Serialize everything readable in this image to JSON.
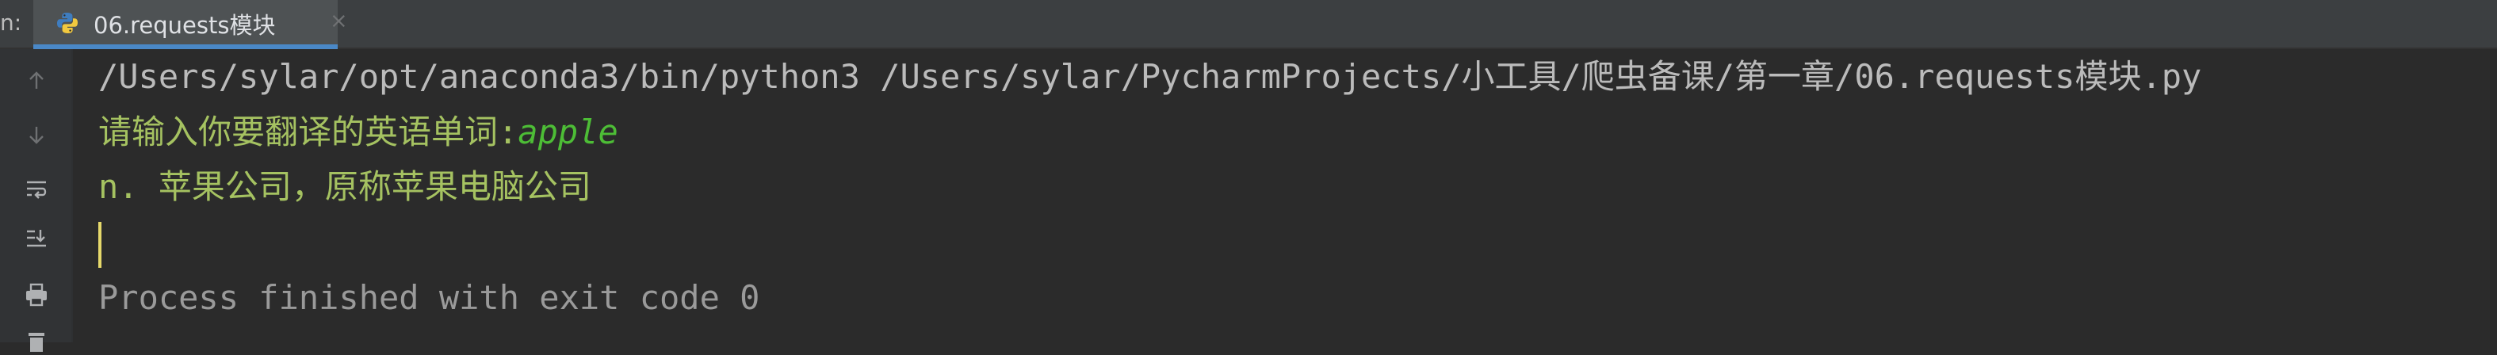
{
  "panel": {
    "label": "n:"
  },
  "tab": {
    "icon": "python-icon",
    "title": "06.requests模块",
    "close_glyph": "×"
  },
  "gutter": {
    "icons": [
      "arrow-up-icon",
      "arrow-down-icon",
      "soft-wrap-icon",
      "scroll-to-end-icon",
      "print-icon",
      "delete-icon"
    ]
  },
  "console": {
    "command": "/Users/sylar/opt/anaconda3/bin/python3 /Users/sylar/PycharmProjects/小工具/爬虫备课/第一章/06.requests模块.py",
    "prompt": "请输入你要翻译的英语单词:",
    "user_input": "apple",
    "output": "n. 苹果公司，原称苹果电脑公司",
    "exit_message": "Process finished with exit code 0"
  },
  "colors": {
    "background": "#2b2b2b",
    "command": "#bbbbbb",
    "program_output": "#a5c261",
    "user_input": "#4dbd36",
    "exit_message": "#9a9a9a",
    "caret": "#e6d96b",
    "tab_accent": "#4a88c7"
  }
}
